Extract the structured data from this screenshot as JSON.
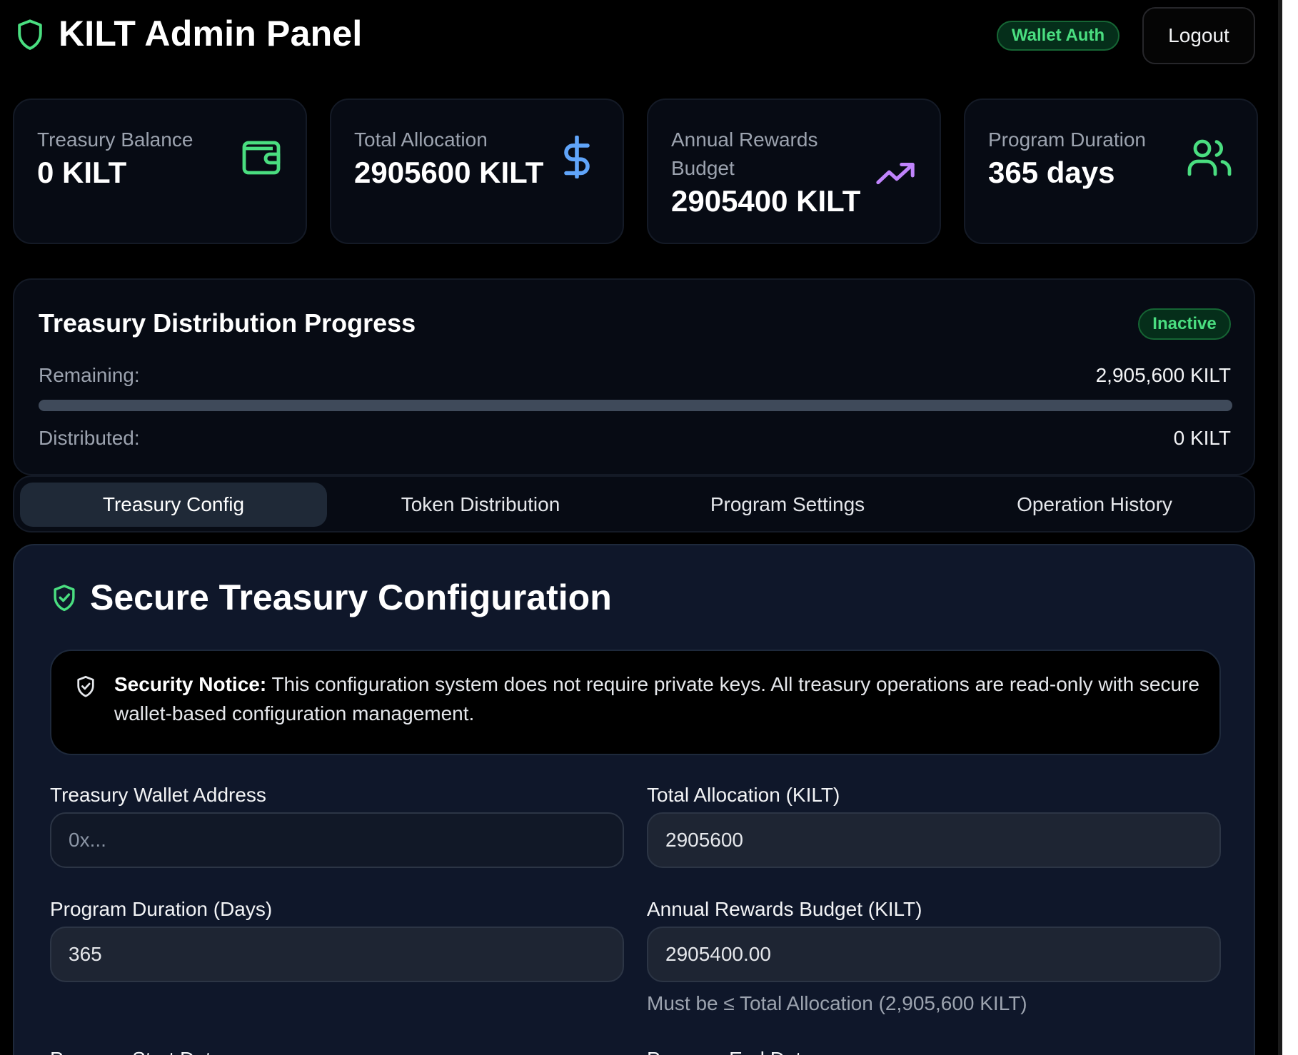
{
  "header": {
    "title": "KILT Admin Panel",
    "auth_badge": "Wallet Auth",
    "logout_label": "Logout"
  },
  "stats": [
    {
      "label": "Treasury Balance",
      "value": "0 KILT",
      "icon": "wallet-icon",
      "icon_color": "#4ade80"
    },
    {
      "label": "Total Allocation",
      "value": "2905600 KILT",
      "icon": "dollar-icon",
      "icon_color": "#60a5fa"
    },
    {
      "label": "Annual Rewards Budget",
      "value": "2905400 KILT",
      "icon": "trending-up-icon",
      "icon_color": "#c084fc"
    },
    {
      "label": "Program Duration",
      "value": "365 days",
      "icon": "users-icon",
      "icon_color": "#4ade80"
    }
  ],
  "progress": {
    "title": "Treasury Distribution Progress",
    "status": "Inactive",
    "remaining_label": "Remaining:",
    "remaining_value": "2,905,600 KILT",
    "distributed_label": "Distributed:",
    "distributed_value": "0 KILT",
    "distributed_fraction": 0
  },
  "tabs": [
    {
      "label": "Treasury Config",
      "active": true
    },
    {
      "label": "Token Distribution",
      "active": false
    },
    {
      "label": "Program Settings",
      "active": false
    },
    {
      "label": "Operation History",
      "active": false
    }
  ],
  "config": {
    "title": "Secure Treasury Configuration",
    "notice_bold": "Security Notice:",
    "notice_text": " This configuration system does not require private keys. All treasury operations are read-only with secure wallet-based configuration management.",
    "fields": {
      "wallet_address": {
        "label": "Treasury Wallet Address",
        "value": "",
        "placeholder": "0x..."
      },
      "total_allocation": {
        "label": "Total Allocation (KILT)",
        "value": "2905600"
      },
      "program_duration": {
        "label": "Program Duration (Days)",
        "value": "365"
      },
      "annual_budget": {
        "label": "Annual Rewards Budget (KILT)",
        "value": "2905400.00",
        "hint": "Must be ≤ Total Allocation (2,905,600 KILT)"
      },
      "start_date": {
        "label": "Program Start Date"
      },
      "end_date": {
        "label": "Program End Date"
      }
    }
  },
  "colors": {
    "accent_green": "#4ade80",
    "accent_blue": "#60a5fa",
    "accent_purple": "#c084fc"
  }
}
